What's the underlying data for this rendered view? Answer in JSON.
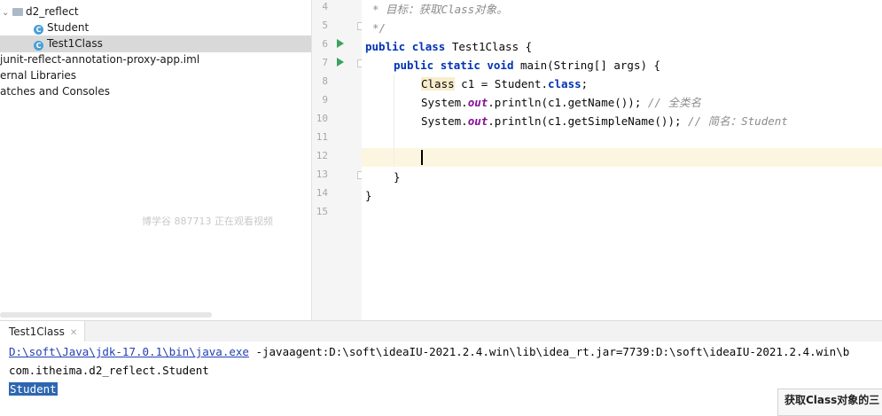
{
  "project_tree": {
    "items": [
      {
        "label": "d2_reflect",
        "kind": "package",
        "expanded": true
      },
      {
        "label": "Student",
        "kind": "class"
      },
      {
        "label": "Test1Class",
        "kind": "class",
        "selected": true
      },
      {
        "label": "junit-reflect-annotation-proxy-app.iml",
        "kind": "file"
      },
      {
        "label": "ernal Libraries",
        "kind": "libraries"
      },
      {
        "label": "atches and Consoles",
        "kind": "scratches"
      }
    ],
    "watermark": "博学谷 887713 正在观看视频"
  },
  "editor": {
    "line_numbers": [
      "4",
      "5",
      "6",
      "7",
      "8",
      "9",
      "10",
      "11",
      "12",
      "13",
      "14",
      "15"
    ],
    "lines": {
      "l4_comment": "* 目标：获取Class对象。",
      "l5_comment": "*/",
      "l6_kw1": "public",
      "l6_kw2": "class",
      "l6_rest": " Test1Class {",
      "l7_kw1": "public",
      "l7_kw2": "static",
      "l7_kw3": "void",
      "l7_rest": " main(String[] args) {",
      "l8_type": "Class",
      "l8_mid": " c1 = Student.",
      "l8_kw": "class",
      "l8_end": ";",
      "l9_a": "System.",
      "l9_field": "out",
      "l9_b": ".println(c1.getName()); ",
      "l9_comment": "// 全类名",
      "l10_a": "System.",
      "l10_field": "out",
      "l10_b": ".println(c1.getSimpleName()); ",
      "l10_comment": "// 简名：Student",
      "l13": "}",
      "l14": "}"
    }
  },
  "run_panel": {
    "tab_label": "Test1Class",
    "console": {
      "cmd_link": "D:\\soft\\Java\\jdk-17.0.1\\bin\\java.exe",
      "cmd_rest": " -javaagent:D:\\soft\\ideaIU-2021.2.4.win\\lib\\idea_rt.jar=7739:D:\\soft\\ideaIU-2021.2.4.win\\b",
      "line2": "com.itheima.d2_reflect.Student",
      "line3": "Student"
    }
  },
  "notice": "获取Class对象的三",
  "colors": {
    "keyword": "#0033b3",
    "comment": "#8c8c8c",
    "field": "#871094",
    "run_icon": "#3aa35f",
    "selection": "#2e67b0"
  }
}
